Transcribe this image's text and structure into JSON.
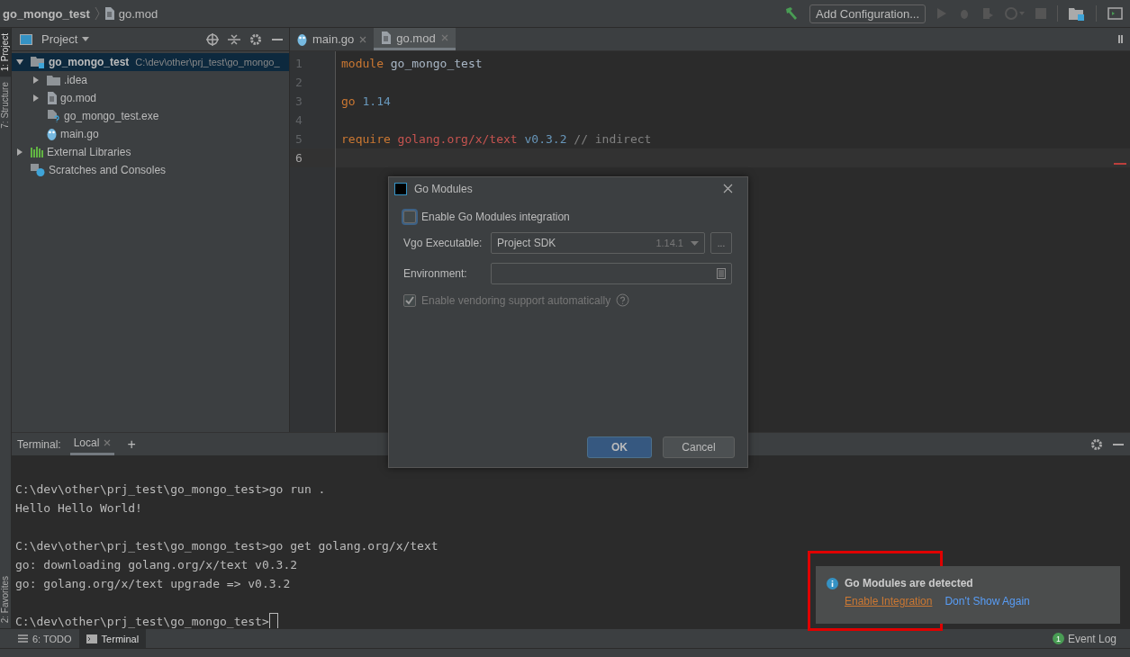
{
  "breadcrumb": [
    {
      "label": "go_mongo_test",
      "kind": "project"
    },
    {
      "label": "go.mod",
      "kind": "file"
    }
  ],
  "toolbar": {
    "config_button": "Add Configuration..."
  },
  "side_tabs_top": [
    {
      "label": "1: Project",
      "selected": true
    },
    {
      "label": "7: Structure",
      "selected": false
    }
  ],
  "side_tabs_bottom": [
    {
      "label": "2: Favorites",
      "selected": false
    }
  ],
  "project_panel": {
    "title": "Project",
    "tree": [
      {
        "label": "go_mongo_test",
        "path": "C:\\dev\\other\\prj_test\\go_mongo_",
        "kind": "module",
        "expanded": true,
        "selected": true,
        "children": [
          {
            "label": ".idea",
            "kind": "folder",
            "expanded": false,
            "selected": false
          },
          {
            "label": "go.mod",
            "kind": "file",
            "expanded": false,
            "selected": false
          },
          {
            "label": "go_mongo_test.exe",
            "kind": "unknown",
            "selected": false
          },
          {
            "label": "main.go",
            "kind": "gofile",
            "selected": false
          }
        ]
      },
      {
        "label": "External Libraries",
        "kind": "libraries",
        "expanded": false,
        "selected": false
      },
      {
        "label": "Scratches and Consoles",
        "kind": "scratches",
        "selected": false
      }
    ]
  },
  "editor_tabs": [
    {
      "label": "main.go",
      "kind": "gofile",
      "selected": false
    },
    {
      "label": "go.mod",
      "kind": "file",
      "selected": true
    }
  ],
  "editor_lines": [
    {
      "number": "1",
      "tokens": [
        {
          "text": "module",
          "kind": "keyword"
        },
        {
          "text": " go_mongo_test",
          "kind": "ident"
        }
      ]
    },
    {
      "number": "2"
    },
    {
      "number": "3",
      "tokens": [
        {
          "text": "go",
          "kind": "keyword"
        },
        {
          "text": " 1.14",
          "kind": "number"
        }
      ]
    },
    {
      "number": "4"
    },
    {
      "number": "5",
      "tokens": [
        {
          "text": "require",
          "kind": "keyword"
        },
        {
          "text": " golang.org/x/text",
          "kind": "string"
        },
        {
          "text": " v0.3.2",
          "kind": "number"
        },
        {
          "text": " // indirect",
          "kind": "comment"
        }
      ]
    },
    {
      "number": "6",
      "selected": true
    }
  ],
  "dialog": {
    "title": "Go Modules",
    "enable_checkbox": {
      "label": "Enable Go Modules integration",
      "checked": false
    },
    "vgo_label": "Vgo Executable:",
    "vgo_value": "Project SDK",
    "vgo_version": "1.14.1",
    "browse_button": "...",
    "environment_label": "Environment:",
    "vendoring_checkbox": {
      "label": "Enable vendoring support automatically",
      "checked": true,
      "disabled": true
    },
    "ok_button": "OK",
    "cancel_button": "Cancel"
  },
  "terminal": {
    "label": "Terminal:",
    "tabs": [
      {
        "label": "Local",
        "selected": true
      }
    ],
    "add_button": "+",
    "blocks": [
      [
        "C:\\dev\\other\\prj_test\\go_mongo_test>go run .",
        "Hello Hello World!"
      ],
      [
        "C:\\dev\\other\\prj_test\\go_mongo_test>go get golang.org/x/text",
        "go: downloading golang.org/x/text v0.3.2",
        "go: golang.org/x/text upgrade => v0.3.2"
      ]
    ],
    "prompt": "C:\\dev\\other\\prj_test\\go_mongo_test>"
  },
  "bottom_tabs": [
    {
      "label": "6: TODO",
      "kind": "todo",
      "selected": false
    },
    {
      "label": "Terminal",
      "kind": "terminal",
      "selected": true
    }
  ],
  "event_log": {
    "count": "1",
    "label": "Event Log"
  },
  "notification": {
    "title": "Go Modules are detected",
    "actions": [
      {
        "label": "Enable Integration",
        "kind": "primary"
      },
      {
        "label": "Don't Show Again",
        "kind": "secondary"
      }
    ]
  }
}
